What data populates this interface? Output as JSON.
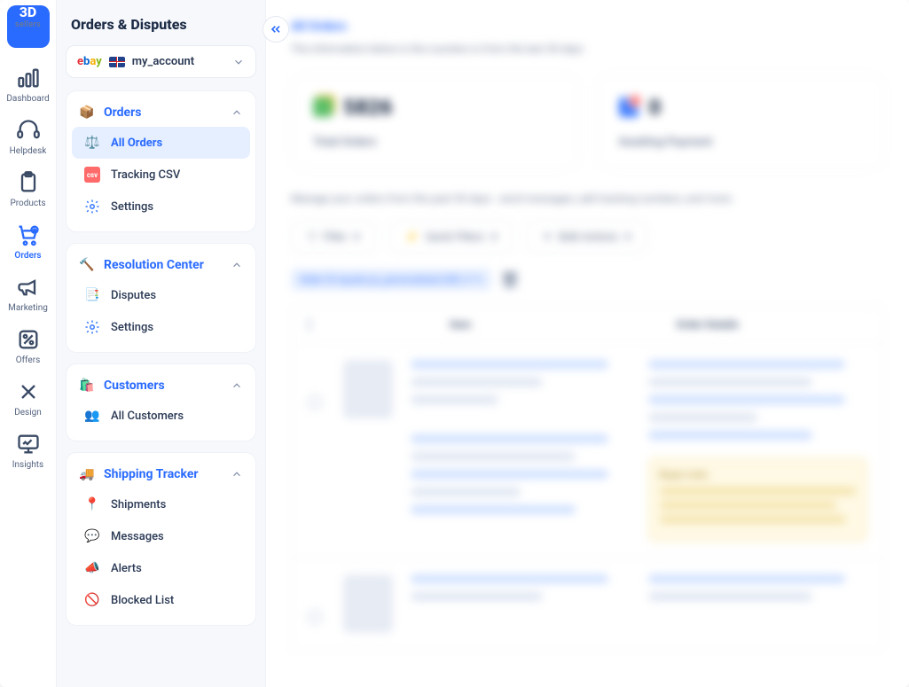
{
  "brand": {
    "top": "3D",
    "sub": "sellers"
  },
  "rail": [
    {
      "id": "dashboard",
      "label": "Dashboard"
    },
    {
      "id": "helpdesk",
      "label": "Helpdesk"
    },
    {
      "id": "products",
      "label": "Products"
    },
    {
      "id": "orders",
      "label": "Orders",
      "active": true
    },
    {
      "id": "marketing",
      "label": "Marketing"
    },
    {
      "id": "offers",
      "label": "Offers"
    },
    {
      "id": "design",
      "label": "Design"
    },
    {
      "id": "insights",
      "label": "Insights"
    }
  ],
  "page_title": "Orders & Disputes",
  "account": {
    "name": "my_account"
  },
  "sections": {
    "orders": {
      "title": "Orders",
      "items": [
        {
          "id": "all-orders",
          "label": "All Orders",
          "icon": "⚖️",
          "active": true
        },
        {
          "id": "tracking-csv",
          "label": "Tracking CSV",
          "icon": "csv"
        },
        {
          "id": "settings",
          "label": "Settings",
          "icon": "gear"
        }
      ]
    },
    "resolution": {
      "title": "Resolution Center",
      "items": [
        {
          "id": "disputes",
          "label": "Disputes",
          "icon": "📑"
        },
        {
          "id": "settings",
          "label": "Settings",
          "icon": "gear"
        }
      ]
    },
    "customers": {
      "title": "Customers",
      "items": [
        {
          "id": "all-customers",
          "label": "All Customers",
          "icon": "👥"
        }
      ]
    },
    "shipping": {
      "title": "Shipping Tracker",
      "items": [
        {
          "id": "shipments",
          "label": "Shipments",
          "icon": "📍"
        },
        {
          "id": "messages",
          "label": "Messages",
          "icon": "💬"
        },
        {
          "id": "alerts",
          "label": "Alerts",
          "icon": "📣"
        },
        {
          "id": "blocked",
          "label": "Blocked List",
          "icon": "🚫"
        }
      ]
    }
  },
  "main": {
    "heading": "All Orders",
    "subtitle": "The information below in the counters is from the last 30 days",
    "stats": [
      {
        "value": "5826",
        "label": "Total Orders",
        "icon": "green"
      },
      {
        "value": "0",
        "label": "Awaiting Payment",
        "icon": "blue"
      }
    ],
    "desc": "Manage your orders from the past 90 days - send messages, add tracking numbers, and more.",
    "toolbar": {
      "filter": "Filter",
      "quick": "Quick Filters",
      "bulk": "Bulk Actions"
    },
    "tag": "Seller ID equals ps_personalised (UK)",
    "table": {
      "col_item": "Item",
      "col_details": "Order Details"
    },
    "note_title": "Buyer note:"
  }
}
